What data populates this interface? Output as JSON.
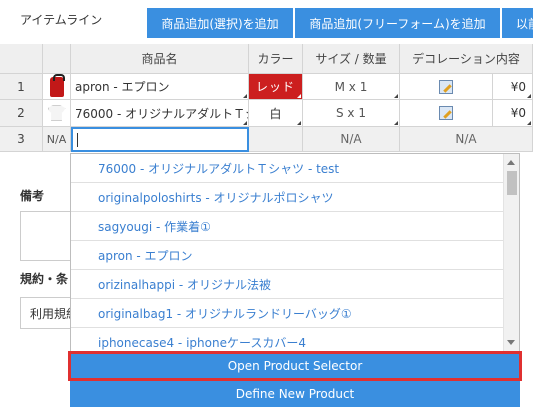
{
  "header": {
    "title": "アイテムライン",
    "buttons": [
      "商品追加(選択)を追加",
      "商品追加(フリーフォーム)を追加",
      "以前"
    ]
  },
  "columns": [
    "商品名",
    "カラー",
    "サイズ / 数量",
    "デコレーション内容"
  ],
  "rows": [
    {
      "num": "1",
      "product": "apron - エプロン",
      "color": "レッド",
      "size": "M x 1",
      "price": "¥0"
    },
    {
      "num": "2",
      "product": "76000 - オリジナルアダルトＴシ",
      "color": "白",
      "size": "S x 1",
      "price": "¥0"
    },
    {
      "num": "3",
      "na_image": "N/A",
      "product": "",
      "size": "N/A",
      "decoration": "N/A"
    }
  ],
  "below": {
    "remarks_label": "備考",
    "terms_label": "規約・条",
    "terms_value": "利用規約"
  },
  "dropdown": {
    "items": [
      "76000 - オリジナルアダルトＴシャツ - test",
      "originalpoloshirts - オリジナルポロシャツ",
      "sagyougi - 作業着①",
      "apron - エプロン",
      "orizinalhappi - オリジナル法被",
      "originalbag1 - オリジナルランドリーバッグ①",
      "iphonecase4 - iphoneケースカバー4"
    ],
    "open_selector": "Open Product Selector",
    "define_new": "Define New Product"
  },
  "colors": {
    "accent": "#3a8fe0",
    "red_swatch": "#cc1f1f",
    "highlight": "#e03030",
    "link": "#3a7fd0"
  }
}
